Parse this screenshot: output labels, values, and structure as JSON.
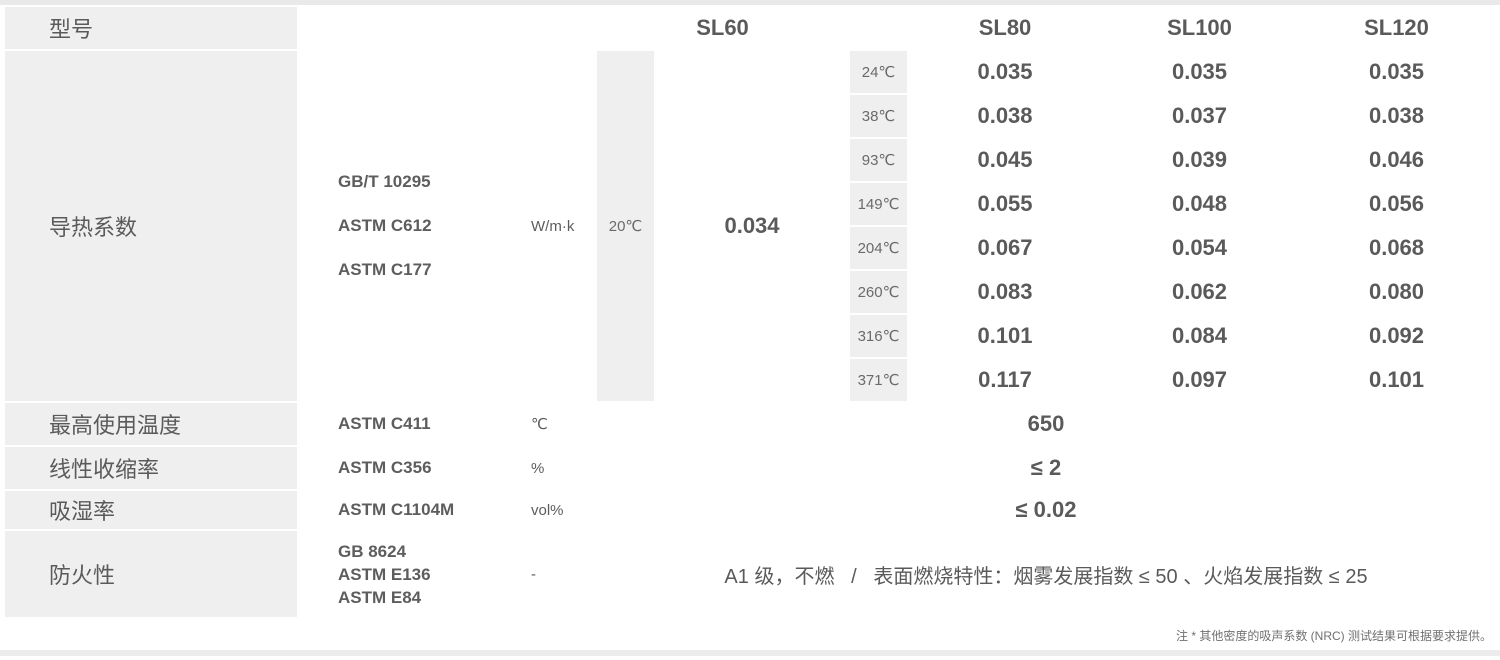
{
  "header": {
    "model_label": "型号",
    "models": [
      "SL60",
      "SL80",
      "SL100",
      "SL120"
    ]
  },
  "thermal": {
    "label": "导热系数",
    "standards": [
      "GB/T 10295",
      "ASTM C612",
      "ASTM C177"
    ],
    "unit": "W/m·k",
    "sl60_temp": "20℃",
    "sl60_value": "0.034",
    "rows": [
      {
        "temp": "24℃",
        "sl80": "0.035",
        "sl100": "0.035",
        "sl120": "0.035"
      },
      {
        "temp": "38℃",
        "sl80": "0.038",
        "sl100": "0.037",
        "sl120": "0.038"
      },
      {
        "temp": "93℃",
        "sl80": "0.045",
        "sl100": "0.039",
        "sl120": "0.046"
      },
      {
        "temp": "149℃",
        "sl80": "0.055",
        "sl100": "0.048",
        "sl120": "0.056"
      },
      {
        "temp": "204℃",
        "sl80": "0.067",
        "sl100": "0.054",
        "sl120": "0.068"
      },
      {
        "temp": "260℃",
        "sl80": "0.083",
        "sl100": "0.062",
        "sl120": "0.080"
      },
      {
        "temp": "316℃",
        "sl80": "0.101",
        "sl100": "0.084",
        "sl120": "0.092"
      },
      {
        "temp": "371℃",
        "sl80": "0.117",
        "sl100": "0.097",
        "sl120": "0.101"
      }
    ]
  },
  "max_temp": {
    "label": "最高使用温度",
    "standard": "ASTM C411",
    "unit": "℃",
    "value": "650"
  },
  "shrink": {
    "label": "线性收缩率",
    "standard": "ASTM C356",
    "unit": "%",
    "value": "≤ 2"
  },
  "moisture": {
    "label": "吸湿率",
    "standard": "ASTM C1104M",
    "unit": "vol%",
    "value": "≤ 0.02"
  },
  "fire": {
    "label": "防火性",
    "standards": [
      "GB 8624",
      "ASTM E136",
      "ASTM E84"
    ],
    "unit": "-",
    "value": "A1 级，不燃   /   表面燃烧特性：烟雾发展指数 ≤ 50 、火焰发展指数 ≤ 25"
  },
  "note": "注 * 其他密度的吸声系数 (NRC) 测试结果可根据要求提供。"
}
